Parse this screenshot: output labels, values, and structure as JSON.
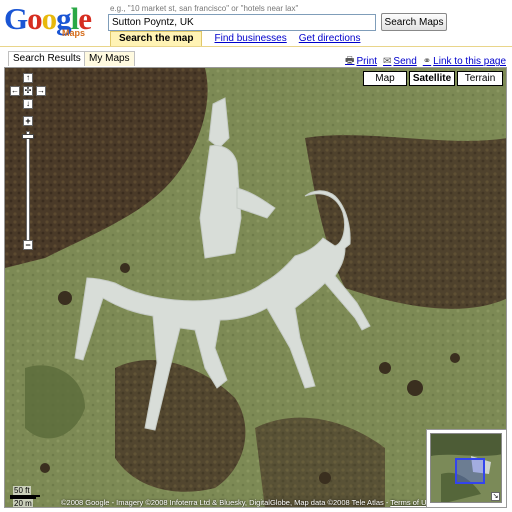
{
  "header": {
    "logo_text": "Google",
    "logo_sub": "Maps",
    "search_hint": "e.g., \"10 market st, san francisco\" or \"hotels near lax\"",
    "search_value": "Sutton Poyntz, UK",
    "search_button": "Search Maps",
    "tabs": {
      "active": "Search the map",
      "find_businesses": "Find businesses",
      "get_directions": "Get directions"
    }
  },
  "panel_tabs": {
    "search_results": "Search Results",
    "my_maps": "My Maps"
  },
  "actions": {
    "print": "Print",
    "send": "Send",
    "link": "Link to this page",
    "print_icon": "printer-icon",
    "send_icon": "envelope-icon",
    "link_icon": "chain-link-icon"
  },
  "map_types": {
    "map": "Map",
    "satellite": "Satellite",
    "terrain": "Terrain",
    "selected": "Satellite"
  },
  "controls": {
    "pan_up": "↑",
    "pan_left": "←",
    "pan_center": "✣",
    "pan_right": "→",
    "pan_down": "↓",
    "zoom_in": "+",
    "zoom_out": "−"
  },
  "scale": {
    "feet": "50 ft",
    "meters": "20 m"
  },
  "copyright": {
    "text": "©2008 Google - Imagery ©2008 Infoterra Ltd & Bluesky, DigitalGlobe, Map data ©2008 Tele Atlas - ",
    "terms": "Terms of Use"
  },
  "overview": {
    "collapse": "↘"
  },
  "colors": {
    "accent_yellow": "#fff3b5",
    "link_blue": "#0000cc",
    "overview_box": "#3344ee"
  }
}
